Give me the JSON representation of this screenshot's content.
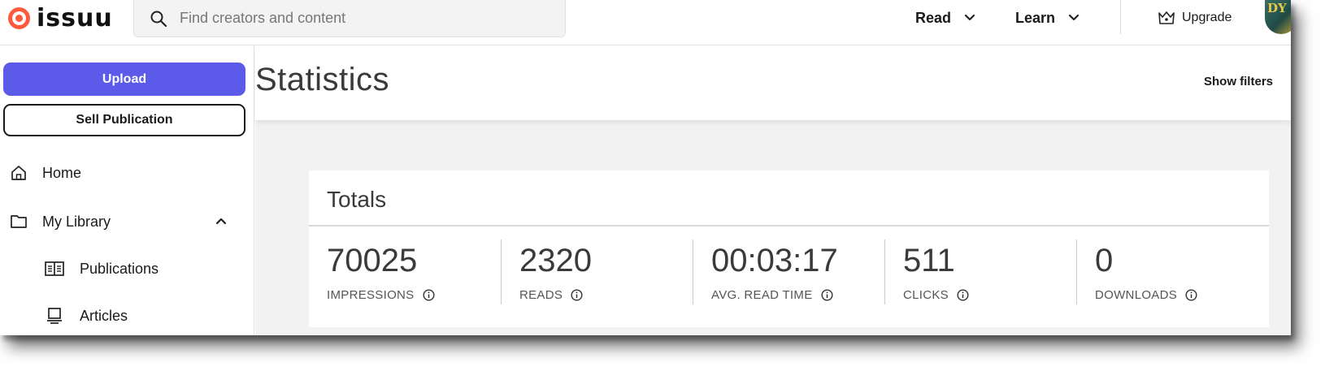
{
  "brand": {
    "name": "issuu",
    "color": "#ff5a3c"
  },
  "search": {
    "placeholder": "Find creators and content"
  },
  "nav": {
    "read_label": "Read",
    "learn_label": "Learn",
    "upgrade_label": "Upgrade"
  },
  "sidebar": {
    "upload_label": "Upload",
    "sell_label": "Sell Publication",
    "items": [
      {
        "label": "Home",
        "icon": "home-icon"
      },
      {
        "label": "My Library",
        "icon": "folder-icon",
        "expanded": true
      },
      {
        "label": "Publications",
        "icon": "book-icon"
      },
      {
        "label": "Articles",
        "icon": "article-icon"
      }
    ]
  },
  "main": {
    "title": "Statistics",
    "show_filters_label": "Show filters",
    "totals": {
      "title": "Totals",
      "stats": [
        {
          "value": "70025",
          "label": "IMPRESSIONS"
        },
        {
          "value": "2320",
          "label": "READS"
        },
        {
          "value": "00:03:17",
          "label": "AVG. READ TIME"
        },
        {
          "value": "511",
          "label": "CLICKS"
        },
        {
          "value": "0",
          "label": "DOWNLOADS"
        }
      ]
    }
  },
  "colors": {
    "accent": "#5c5ae8",
    "background": "#f2f2f2"
  }
}
